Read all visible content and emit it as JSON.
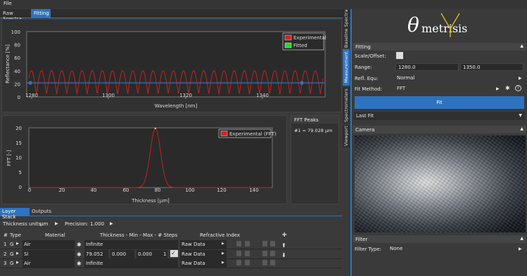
{
  "menu": {
    "file": "File"
  },
  "tabs": [
    {
      "label": "Raw Spectra"
    },
    {
      "label": "Fitting"
    }
  ],
  "spectrum_chart": {
    "ylabel": "Reflectance [%]",
    "xlabel": "Wavelength [nm]",
    "legend": [
      "Experimental",
      "Fitted"
    ],
    "yticks": [
      "100",
      "80",
      "60",
      "40",
      "20",
      "0"
    ],
    "xticks": [
      "1280",
      "1300",
      "1320",
      "1340"
    ]
  },
  "fft_chart": {
    "ylabel": "FFT [-]",
    "xlabel": "Thickness [µm]",
    "legend": [
      "Experimental (FFT)"
    ],
    "yticks": [
      "20",
      "15",
      "10",
      "5",
      "0"
    ],
    "xticks": [
      "0",
      "20",
      "40",
      "60",
      "80",
      "100",
      "120",
      "140"
    ]
  },
  "fft_peaks": {
    "title": "FFT Peaks",
    "item": "#1 = 79.028 µm"
  },
  "bottom_tabs": [
    {
      "label": "Layer Stack"
    },
    {
      "label": "Outputs"
    }
  ],
  "units": {
    "thickness_label": "Thickness units:",
    "thickness_value": "µm",
    "precision_label": "Precision:",
    "precision_value": "1.000"
  },
  "layer_table": {
    "headers": {
      "num": "#",
      "type": "Type",
      "material": "Material",
      "thickness": "Thickness - Min - Max - # Steps",
      "index": "Refractive Index"
    },
    "rows": [
      {
        "num": "1",
        "type": "G",
        "material": "Air",
        "thickness": "Infinite",
        "min": "",
        "max": "",
        "steps": "",
        "index": "Raw Data"
      },
      {
        "num": "2",
        "type": "G",
        "material": "Si",
        "thickness": "79.052",
        "min": "0.000",
        "max": "0.000",
        "steps": "1",
        "index": "Raw Data"
      },
      {
        "num": "3",
        "type": "G",
        "material": "Air",
        "thickness": "Infinite",
        "min": "",
        "max": "",
        "steps": "",
        "index": "Raw Data"
      }
    ]
  },
  "side_tabs": [
    "Baseline Spectra",
    "Measurement",
    "Spectrometers",
    "Viewport"
  ],
  "logo": {
    "theta": "θ",
    "text": "metrisis"
  },
  "fitting": {
    "section": "Fitting",
    "scale_label": "Scale/Offset:",
    "range_label": "Range:",
    "range_min": "1280.0",
    "range_max": "1350.0",
    "refl_label": "Refl. Equ:",
    "refl_value": "Normal",
    "method_label": "Fit Method:",
    "method_value": "FFT",
    "fit_button": "Fit",
    "last_fit": "Last Fit"
  },
  "camera": {
    "section": "Camera"
  },
  "filter": {
    "section": "Filter",
    "type_label": "Filter Type:",
    "type_value": "None"
  },
  "colors": {
    "accent": "#2d73c0",
    "experimental": "#d62020",
    "fitted": "#22dd22"
  }
}
